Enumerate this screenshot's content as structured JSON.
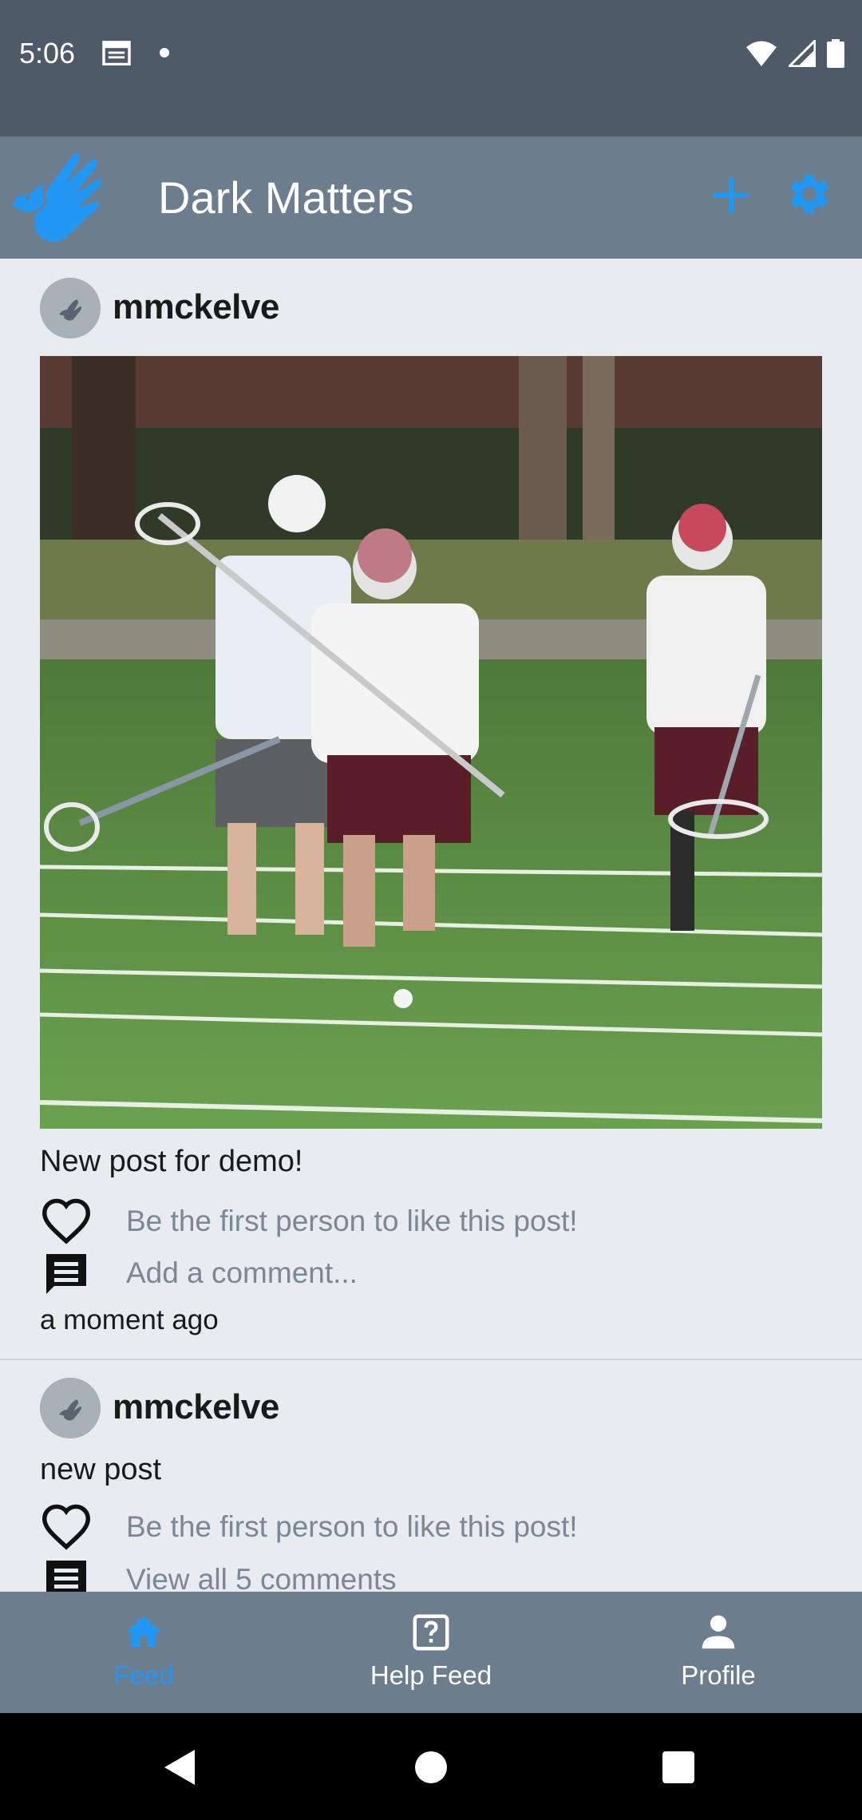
{
  "status": {
    "time": "5:06"
  },
  "app": {
    "title": "Dark Matters",
    "accent": "#2196f3"
  },
  "posts": [
    {
      "username": "mmckelve",
      "caption": "New post for demo!",
      "like_text": "Be the first person to like this post!",
      "comment_text": "Add a comment...",
      "time": "a moment ago"
    },
    {
      "username": "mmckelve",
      "caption": "new post",
      "like_text": "Be the first person to like this post!",
      "comment_text": "View all 5 comments"
    }
  ],
  "nav": {
    "items": [
      {
        "label": "Feed",
        "icon": "home-icon",
        "active": true
      },
      {
        "label": "Help Feed",
        "icon": "help-box-icon",
        "active": false
      },
      {
        "label": "Profile",
        "icon": "person-icon",
        "active": false
      }
    ]
  },
  "colors": {
    "status_bar": "#4f5a68",
    "app_bar": "#6c7d8e",
    "background": "#e8ebef"
  }
}
